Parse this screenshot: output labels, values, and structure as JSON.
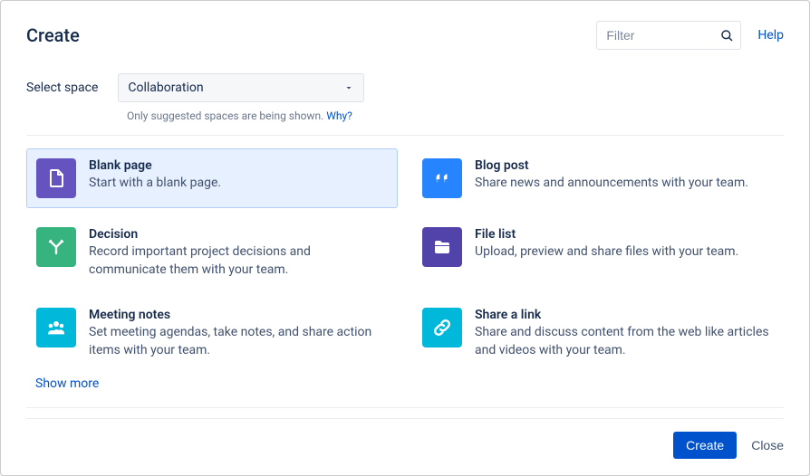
{
  "header": {
    "title": "Create",
    "filter_placeholder": "Filter",
    "help_label": "Help"
  },
  "space": {
    "label": "Select space",
    "selected": "Collaboration",
    "hint_text": "Only suggested spaces are being shown. ",
    "hint_link": "Why?"
  },
  "templates": [
    {
      "id": "blank-page",
      "title": "Blank page",
      "desc": "Start with a blank page.",
      "icon": "file-icon",
      "color": "ic-purple",
      "selected": true
    },
    {
      "id": "blog-post",
      "title": "Blog post",
      "desc": "Share news and announcements with your team.",
      "icon": "quote-icon",
      "color": "ic-blue",
      "selected": false
    },
    {
      "id": "decision",
      "title": "Decision",
      "desc": "Record important project decisions and communicate them with your team.",
      "icon": "branch-icon",
      "color": "ic-green",
      "selected": false
    },
    {
      "id": "file-list",
      "title": "File list",
      "desc": "Upload, preview and share files with your team.",
      "icon": "folder-icon",
      "color": "ic-darkpurple",
      "selected": false
    },
    {
      "id": "meeting-notes",
      "title": "Meeting notes",
      "desc": "Set meeting agendas, take notes, and share action items with your team.",
      "icon": "people-icon",
      "color": "ic-teal",
      "selected": false
    },
    {
      "id": "share-a-link",
      "title": "Share a link",
      "desc": "Share and discuss content from the web like articles and videos with your team.",
      "icon": "link-icon",
      "color": "ic-teal",
      "selected": false
    }
  ],
  "show_more_label": "Show more",
  "footer": {
    "create_label": "Create",
    "close_label": "Close"
  }
}
